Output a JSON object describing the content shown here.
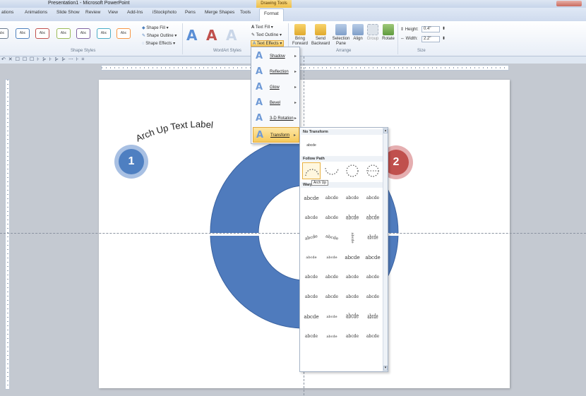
{
  "window": {
    "title": "Presentation1 - Microsoft PowerPoint",
    "contextual_tab": "Drawing Tools"
  },
  "tabs": [
    "ations",
    "Animations",
    "Slide Show",
    "Review",
    "View",
    "Add-Ins",
    "iStockphoto",
    "Pens",
    "Merge Shapes",
    "Tools",
    "Format"
  ],
  "active_tab": "Format",
  "ribbon": {
    "shape_styles": {
      "swatch_label": "Abc",
      "label": "Shape Styles",
      "fill": "Shape Fill",
      "outline": "Shape Outline",
      "effects": "Shape Effects"
    },
    "wordart": {
      "label": "WordArt Styles",
      "letter": "A",
      "text_fill": "Text Fill",
      "text_outline": "Text Outline",
      "text_effects": "Text Effects"
    },
    "arrange": {
      "label": "Arrange",
      "bring_forward": [
        "Bring",
        "Forward"
      ],
      "send_backward": [
        "Send",
        "Backward"
      ],
      "selection_pane": [
        "Selection",
        "Pane"
      ],
      "align": "Align",
      "group": "Group",
      "rotate": "Rotate"
    },
    "size": {
      "label": "Size",
      "height_label": "Height:",
      "height_value": "0.4\"",
      "width_label": "Width:",
      "width_value": "2.2\""
    }
  },
  "qat": {
    "glyphs": "↶ ✕ ☐ ☐ ☐ ⊦ ⊱ ⊦ ⊱ ⊱ ⋯ ⊦ ="
  },
  "slide": {
    "arch_text": "Arch Up Text Label"
  },
  "badges": [
    {
      "number": "1",
      "color": "#4e7fc1"
    },
    {
      "number": "2",
      "color": "#c0504d"
    }
  ],
  "colors": {
    "donut": "#4f7bbd",
    "donut_stroke": "#3a62a0",
    "swatches": [
      "#6a7a8e",
      "#4f81bd",
      "#c0504d",
      "#9bbb59",
      "#8064a2",
      "#4bacc6",
      "#f79646"
    ],
    "wordart": [
      "#5b8fd6",
      "#c0504d",
      "#c9d6e8"
    ]
  },
  "text_effects_menu": [
    {
      "label": "Shadow",
      "icon": "shadow-icon"
    },
    {
      "label": "Reflection",
      "icon": "reflection-icon"
    },
    {
      "label": "Glow",
      "icon": "glow-icon"
    },
    {
      "label": "Bevel",
      "icon": "bevel-icon"
    },
    {
      "label": "3-D Rotation",
      "icon": "rotation-3d-icon"
    },
    {
      "label": "Transform",
      "icon": "transform-icon",
      "selected": true
    }
  ],
  "gallery": {
    "no_transform_header": "No Transform",
    "no_transform_sample": "abcde",
    "follow_path_header": "Follow Path",
    "warp_header": "Warp",
    "tooltip": "Arch Up",
    "follow_path_samples": [
      "a b c d e",
      "a b c d e",
      "a b c d e",
      "a b c d e"
    ],
    "warp_rows": [
      [
        "abcde",
        "abcde",
        "abcde",
        "abcde"
      ],
      [
        "abcde",
        "abcde",
        "abcde",
        "abcde"
      ],
      [
        "abcde",
        "abcde",
        "abcde",
        "abcde"
      ],
      [
        "abcde",
        "abcde",
        "abcde",
        "abcde"
      ],
      [
        "abcde",
        "abcde",
        "abcde",
        "abcde"
      ],
      [
        "abcde",
        "abcde",
        "abcde",
        "abcde"
      ],
      [
        "abcde",
        "abcde",
        "abcde",
        "abcde"
      ],
      [
        "abcde",
        "abcde",
        "abcde",
        "abcde"
      ]
    ]
  }
}
